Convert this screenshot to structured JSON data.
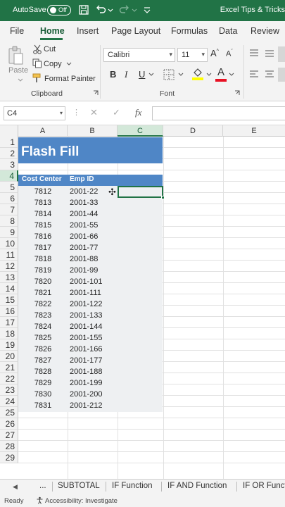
{
  "titlebar": {
    "autosave_label": "AutoSave",
    "autosave_state": "Off",
    "document_title": "Excel Tips & Tricks",
    "accent_color": "#217346"
  },
  "ribbon_tabs": [
    {
      "label": "File"
    },
    {
      "label": "Home"
    },
    {
      "label": "Insert"
    },
    {
      "label": "Page Layout"
    },
    {
      "label": "Formulas"
    },
    {
      "label": "Data"
    },
    {
      "label": "Review"
    }
  ],
  "ribbon": {
    "paste_label": "Paste",
    "cut_label": "Cut",
    "copy_label": "Copy",
    "format_painter_label": "Format Painter",
    "clipboard_group": "Clipboard",
    "font_name": "Calibri",
    "font_size": "11",
    "font_group": "Font",
    "bold_glyph": "B",
    "italic_glyph": "I",
    "underline_glyph": "U",
    "fill_color": "#ffff00",
    "font_color": "#e81123"
  },
  "formula_bar": {
    "name_box": "C4",
    "cancel_glyph": "✕",
    "enter_glyph": "✓",
    "fx_glyph": "fx",
    "value": ""
  },
  "columns": [
    "A",
    "B",
    "C",
    "D",
    "E"
  ],
  "rows": [
    "1",
    "2",
    "3",
    "4",
    "5",
    "6",
    "7",
    "8",
    "9",
    "10",
    "11",
    "12",
    "13",
    "14",
    "15",
    "16",
    "17",
    "18",
    "19",
    "20",
    "21",
    "22",
    "23",
    "24",
    "25",
    "26",
    "27",
    "28",
    "29"
  ],
  "sheet": {
    "title": "Flash Fill",
    "header_a": "Cost Center",
    "header_b": "Emp ID",
    "band_color": "#4f86c6",
    "data": [
      {
        "a": "7812",
        "b": "2001-22"
      },
      {
        "a": "7813",
        "b": "2001-33"
      },
      {
        "a": "7814",
        "b": "2001-44"
      },
      {
        "a": "7815",
        "b": "2001-55"
      },
      {
        "a": "7816",
        "b": "2001-66"
      },
      {
        "a": "7817",
        "b": "2001-77"
      },
      {
        "a": "7818",
        "b": "2001-88"
      },
      {
        "a": "7819",
        "b": "2001-99"
      },
      {
        "a": "7820",
        "b": "2001-101"
      },
      {
        "a": "7821",
        "b": "2001-111"
      },
      {
        "a": "7822",
        "b": "2001-122"
      },
      {
        "a": "7823",
        "b": "2001-133"
      },
      {
        "a": "7824",
        "b": "2001-144"
      },
      {
        "a": "7825",
        "b": "2001-155"
      },
      {
        "a": "7826",
        "b": "2001-166"
      },
      {
        "a": "7827",
        "b": "2001-177"
      },
      {
        "a": "7828",
        "b": "2001-188"
      },
      {
        "a": "7829",
        "b": "2001-199"
      },
      {
        "a": "7830",
        "b": "2001-200"
      },
      {
        "a": "7831",
        "b": "2001-212"
      }
    ]
  },
  "sheet_tabs": {
    "prev_glyph": "◀",
    "ellipsis": "...",
    "tabs": [
      "SUBTOTAL",
      "IF Function",
      "IF AND Function",
      "IF OR Functi"
    ]
  },
  "statusbar": {
    "ready": "Ready",
    "accessibility": "Accessibility: Investigate"
  }
}
